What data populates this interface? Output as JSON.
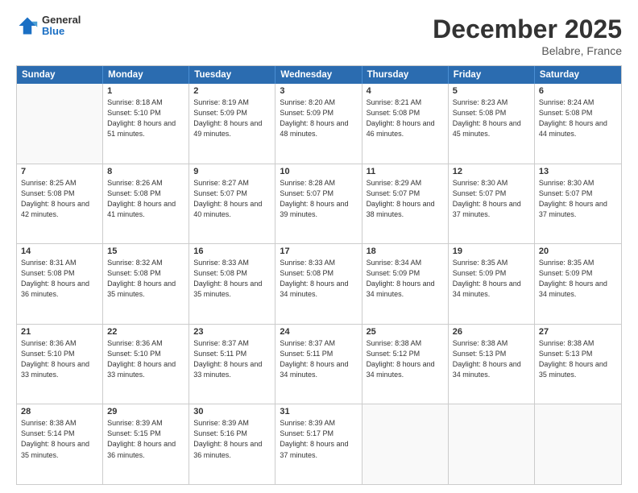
{
  "logo": {
    "general": "General",
    "blue": "Blue"
  },
  "header": {
    "month": "December 2025",
    "location": "Belabre, France"
  },
  "days": [
    "Sunday",
    "Monday",
    "Tuesday",
    "Wednesday",
    "Thursday",
    "Friday",
    "Saturday"
  ],
  "rows": [
    [
      {
        "num": "",
        "sunrise": "",
        "sunset": "",
        "daylight": ""
      },
      {
        "num": "1",
        "sunrise": "Sunrise: 8:18 AM",
        "sunset": "Sunset: 5:10 PM",
        "daylight": "Daylight: 8 hours and 51 minutes."
      },
      {
        "num": "2",
        "sunrise": "Sunrise: 8:19 AM",
        "sunset": "Sunset: 5:09 PM",
        "daylight": "Daylight: 8 hours and 49 minutes."
      },
      {
        "num": "3",
        "sunrise": "Sunrise: 8:20 AM",
        "sunset": "Sunset: 5:09 PM",
        "daylight": "Daylight: 8 hours and 48 minutes."
      },
      {
        "num": "4",
        "sunrise": "Sunrise: 8:21 AM",
        "sunset": "Sunset: 5:08 PM",
        "daylight": "Daylight: 8 hours and 46 minutes."
      },
      {
        "num": "5",
        "sunrise": "Sunrise: 8:23 AM",
        "sunset": "Sunset: 5:08 PM",
        "daylight": "Daylight: 8 hours and 45 minutes."
      },
      {
        "num": "6",
        "sunrise": "Sunrise: 8:24 AM",
        "sunset": "Sunset: 5:08 PM",
        "daylight": "Daylight: 8 hours and 44 minutes."
      }
    ],
    [
      {
        "num": "7",
        "sunrise": "Sunrise: 8:25 AM",
        "sunset": "Sunset: 5:08 PM",
        "daylight": "Daylight: 8 hours and 42 minutes."
      },
      {
        "num": "8",
        "sunrise": "Sunrise: 8:26 AM",
        "sunset": "Sunset: 5:08 PM",
        "daylight": "Daylight: 8 hours and 41 minutes."
      },
      {
        "num": "9",
        "sunrise": "Sunrise: 8:27 AM",
        "sunset": "Sunset: 5:07 PM",
        "daylight": "Daylight: 8 hours and 40 minutes."
      },
      {
        "num": "10",
        "sunrise": "Sunrise: 8:28 AM",
        "sunset": "Sunset: 5:07 PM",
        "daylight": "Daylight: 8 hours and 39 minutes."
      },
      {
        "num": "11",
        "sunrise": "Sunrise: 8:29 AM",
        "sunset": "Sunset: 5:07 PM",
        "daylight": "Daylight: 8 hours and 38 minutes."
      },
      {
        "num": "12",
        "sunrise": "Sunrise: 8:30 AM",
        "sunset": "Sunset: 5:07 PM",
        "daylight": "Daylight: 8 hours and 37 minutes."
      },
      {
        "num": "13",
        "sunrise": "Sunrise: 8:30 AM",
        "sunset": "Sunset: 5:07 PM",
        "daylight": "Daylight: 8 hours and 37 minutes."
      }
    ],
    [
      {
        "num": "14",
        "sunrise": "Sunrise: 8:31 AM",
        "sunset": "Sunset: 5:08 PM",
        "daylight": "Daylight: 8 hours and 36 minutes."
      },
      {
        "num": "15",
        "sunrise": "Sunrise: 8:32 AM",
        "sunset": "Sunset: 5:08 PM",
        "daylight": "Daylight: 8 hours and 35 minutes."
      },
      {
        "num": "16",
        "sunrise": "Sunrise: 8:33 AM",
        "sunset": "Sunset: 5:08 PM",
        "daylight": "Daylight: 8 hours and 35 minutes."
      },
      {
        "num": "17",
        "sunrise": "Sunrise: 8:33 AM",
        "sunset": "Sunset: 5:08 PM",
        "daylight": "Daylight: 8 hours and 34 minutes."
      },
      {
        "num": "18",
        "sunrise": "Sunrise: 8:34 AM",
        "sunset": "Sunset: 5:09 PM",
        "daylight": "Daylight: 8 hours and 34 minutes."
      },
      {
        "num": "19",
        "sunrise": "Sunrise: 8:35 AM",
        "sunset": "Sunset: 5:09 PM",
        "daylight": "Daylight: 8 hours and 34 minutes."
      },
      {
        "num": "20",
        "sunrise": "Sunrise: 8:35 AM",
        "sunset": "Sunset: 5:09 PM",
        "daylight": "Daylight: 8 hours and 34 minutes."
      }
    ],
    [
      {
        "num": "21",
        "sunrise": "Sunrise: 8:36 AM",
        "sunset": "Sunset: 5:10 PM",
        "daylight": "Daylight: 8 hours and 33 minutes."
      },
      {
        "num": "22",
        "sunrise": "Sunrise: 8:36 AM",
        "sunset": "Sunset: 5:10 PM",
        "daylight": "Daylight: 8 hours and 33 minutes."
      },
      {
        "num": "23",
        "sunrise": "Sunrise: 8:37 AM",
        "sunset": "Sunset: 5:11 PM",
        "daylight": "Daylight: 8 hours and 33 minutes."
      },
      {
        "num": "24",
        "sunrise": "Sunrise: 8:37 AM",
        "sunset": "Sunset: 5:11 PM",
        "daylight": "Daylight: 8 hours and 34 minutes."
      },
      {
        "num": "25",
        "sunrise": "Sunrise: 8:38 AM",
        "sunset": "Sunset: 5:12 PM",
        "daylight": "Daylight: 8 hours and 34 minutes."
      },
      {
        "num": "26",
        "sunrise": "Sunrise: 8:38 AM",
        "sunset": "Sunset: 5:13 PM",
        "daylight": "Daylight: 8 hours and 34 minutes."
      },
      {
        "num": "27",
        "sunrise": "Sunrise: 8:38 AM",
        "sunset": "Sunset: 5:13 PM",
        "daylight": "Daylight: 8 hours and 35 minutes."
      }
    ],
    [
      {
        "num": "28",
        "sunrise": "Sunrise: 8:38 AM",
        "sunset": "Sunset: 5:14 PM",
        "daylight": "Daylight: 8 hours and 35 minutes."
      },
      {
        "num": "29",
        "sunrise": "Sunrise: 8:39 AM",
        "sunset": "Sunset: 5:15 PM",
        "daylight": "Daylight: 8 hours and 36 minutes."
      },
      {
        "num": "30",
        "sunrise": "Sunrise: 8:39 AM",
        "sunset": "Sunset: 5:16 PM",
        "daylight": "Daylight: 8 hours and 36 minutes."
      },
      {
        "num": "31",
        "sunrise": "Sunrise: 8:39 AM",
        "sunset": "Sunset: 5:17 PM",
        "daylight": "Daylight: 8 hours and 37 minutes."
      },
      {
        "num": "",
        "sunrise": "",
        "sunset": "",
        "daylight": ""
      },
      {
        "num": "",
        "sunrise": "",
        "sunset": "",
        "daylight": ""
      },
      {
        "num": "",
        "sunrise": "",
        "sunset": "",
        "daylight": ""
      }
    ]
  ]
}
